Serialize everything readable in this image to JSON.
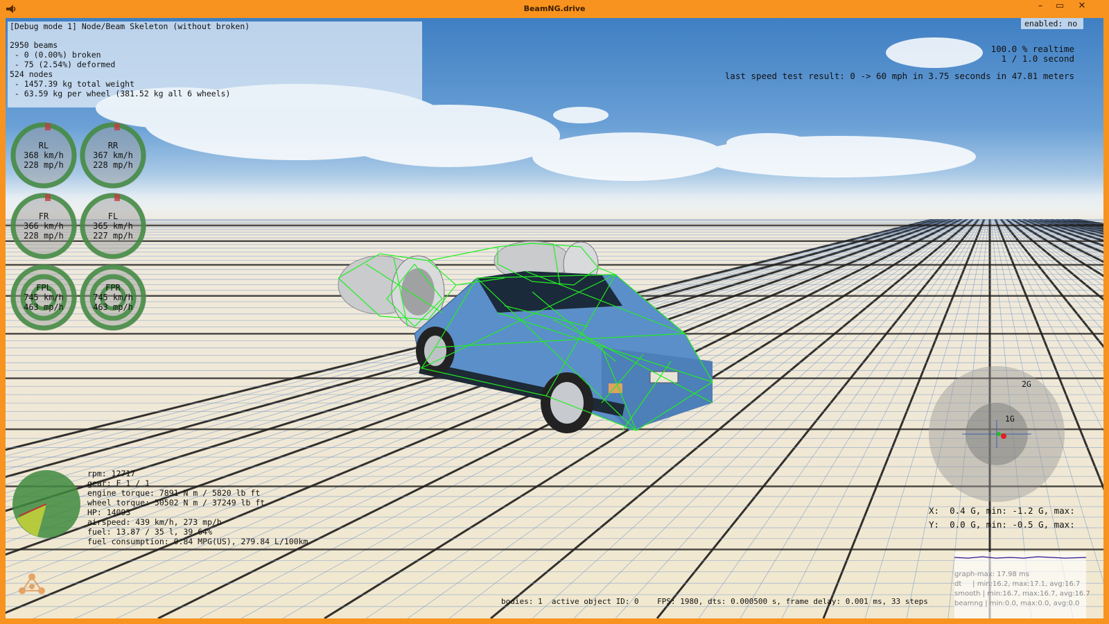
{
  "window": {
    "title": "BeamNG.drive",
    "minimize": "–",
    "maximize": "▭",
    "close": "✕"
  },
  "debug": {
    "header": "[Debug mode 1] Node/Beam Skeleton (without broken)",
    "beams": "2950 beams",
    "broken": " - 0 (0.00%) broken",
    "deformed": " - 75 (2.54%) deformed",
    "nodes": "524 nodes",
    "weight": " - 1457.39 kg total weight",
    "per_wheel": " - 63.59 kg per wheel (381.52 kg all 6 wheels)"
  },
  "enabled_label": "enabled: no",
  "realtime": {
    "pct": "100.0 % realtime",
    "ratio": "1 / 1.0 second",
    "speed_test": "last speed test result: 0 -> 60 mph in 3.75 seconds in 47.81 meters"
  },
  "wheels": [
    {
      "name": "RL",
      "kmh": "368 km/h",
      "mph": "228 mp/h"
    },
    {
      "name": "RR",
      "kmh": "367 km/h",
      "mph": "228 mp/h"
    },
    {
      "name": "FR",
      "kmh": "366 km/h",
      "mph": "228 mp/h"
    },
    {
      "name": "FL",
      "kmh": "365 km/h",
      "mph": "227 mp/h"
    },
    {
      "name": "FPL",
      "kmh": "745 km/h",
      "mph": "463 mp/h"
    },
    {
      "name": "FPR",
      "kmh": "745 km/h",
      "mph": "463 mp/h"
    }
  ],
  "engine": {
    "rpm": "rpm: 12717",
    "gear": "gear: F 1 / 1",
    "engine_torque": "engine torque: 7891 N m / 5820 lb ft",
    "wheel_torque": "wheel torque: 50502 N m / 37249 lb ft",
    "hp": "HP: 14093",
    "airspeed": "airspeed: 439 km/h, 273 mp/h",
    "fuel": "fuel: 13.87 / 35 l, 39.64%",
    "consumption": "fuel consumption: 0.84 MPG(US), 279.84 L/100km"
  },
  "gforce": {
    "label_2g": "2G",
    "label_1g": "1G",
    "x_line": "X:  0.4 G, min: -1.2 G, max:",
    "y_line": "Y:  0.0 G, min: -0.5 G, max:"
  },
  "status": {
    "line": "bodies: 1  active object ID: 0    FPS: 1980, dts: 0.000500 s, frame delay: 0.001 ms, 33 steps"
  },
  "graph": {
    "max": "graph-max: 17.98 ms",
    "dt": "dt     | min:16.2, max:17.1, avg:16.7",
    "smooth": "smooth | min:16.7, max:16.7, avg:16.7",
    "beamng": "beamng | min:0.0, max:0.0, avg:0.0"
  },
  "colors": {
    "title_bar": "#f7931e",
    "wireframe": "#22ee22",
    "car_body": "#5b8fc9",
    "gauge_ring": "#3f8a3f"
  }
}
